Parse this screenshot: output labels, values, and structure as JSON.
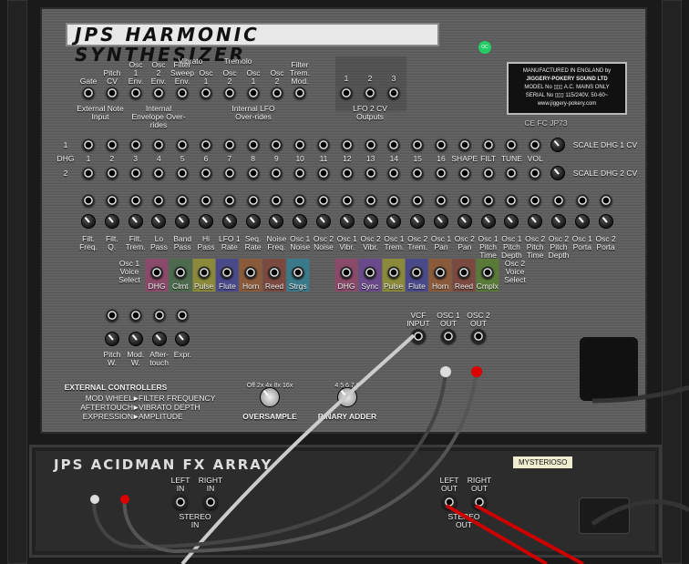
{
  "harmonic": {
    "title": "JPS HARMONIC SYNTHESIZER",
    "led": "OC",
    "top_jacks": [
      [
        "Gate"
      ],
      [
        "Pitch",
        "CV"
      ],
      [
        "Osc",
        "1",
        "Env."
      ],
      [
        "Osc",
        "2",
        "Env."
      ],
      [
        "Filter",
        "Sweep",
        "Env."
      ],
      [
        "Osc",
        "1"
      ],
      [
        "Osc",
        "2"
      ],
      [
        "Osc",
        "1"
      ],
      [
        "Osc",
        "2"
      ],
      [
        "Filter",
        "Trem.",
        "Mod."
      ]
    ],
    "vibrato": "Vibrato",
    "tremolo": "Tremolo",
    "groups": {
      "external": "External Note Input",
      "envelope": "Internal Envelope Over-rides",
      "lfo": "Internal LFO Over-rides",
      "lfo2": "LFO 2 CV Outputs"
    },
    "lfo2_jacks": [
      "1",
      "2",
      "3"
    ],
    "plate": {
      "line1": "MANUFACTURED IN ENGLAND by",
      "line2": "JIGGERY-POKERY SOUND LTD",
      "model": "MODEL No",
      "mains": "A.C. MAINS ONLY",
      "serial": "SERIAL No",
      "volt": "115/240V. 50-60~",
      "url": "www.jiggery-pokery.com",
      "certs": "CE FC JP73"
    },
    "dhg_cols": [
      "1",
      "2",
      "3",
      "4",
      "5",
      "6",
      "7",
      "8",
      "9",
      "10",
      "11",
      "12",
      "13",
      "14",
      "15",
      "16",
      "SHAPE",
      "FILT",
      "TUNE",
      "VOL"
    ],
    "dhg_rows": [
      "1",
      "DHG",
      "2"
    ],
    "scale1": "SCALE DHG 1 CV",
    "scale2": "SCALE DHG 2 CV",
    "knob_cols": [
      [
        "Filt.",
        "Freq."
      ],
      [
        "Filt.",
        "Q."
      ],
      [
        "Filt.",
        "Trem."
      ],
      [
        "Lo",
        "Pass"
      ],
      [
        "Band",
        "Pass"
      ],
      [
        "Hi",
        "Pass"
      ],
      [
        "LFO 1",
        "Rate"
      ],
      [
        "Seq.",
        "Rate"
      ],
      [
        "Noise",
        "Freq."
      ],
      [
        "Osc 1",
        "Noise"
      ],
      [
        "Osc 2",
        "Noise"
      ],
      [
        "Osc 1",
        "Vibr."
      ],
      [
        "Osc 2",
        "Vibr."
      ],
      [
        "Osc 1",
        "Trem."
      ],
      [
        "Osc 2",
        "Trem."
      ],
      [
        "Osc 1",
        "Pan"
      ],
      [
        "Osc 2",
        "Pan"
      ],
      [
        "Osc 1",
        "Pitch",
        "Time"
      ],
      [
        "Osc 1",
        "Pitch",
        "Depth"
      ],
      [
        "Osc 2",
        "Pitch",
        "Time"
      ],
      [
        "Osc 2",
        "Pitch",
        "Depth"
      ],
      [
        "Osc 1",
        "Porta"
      ],
      [
        "Osc 2",
        "Porta"
      ]
    ],
    "osc1_voice_label": [
      "Osc 1",
      "Voice",
      "Select"
    ],
    "osc2_voice_label": [
      "Osc 2",
      "Voice",
      "Select"
    ],
    "osc1_voices": [
      {
        "name": "DHG",
        "color": "#8a4a6a"
      },
      {
        "name": "Clmt",
        "color": "#4e6a4e"
      },
      {
        "name": "Pulse",
        "color": "#8a8a3a"
      },
      {
        "name": "Flute",
        "color": "#4a4a8a"
      },
      {
        "name": "Horn",
        "color": "#8a5a3a"
      },
      {
        "name": "Reed",
        "color": "#7a4a40"
      },
      {
        "name": "Strgs",
        "color": "#3a7a8a"
      }
    ],
    "osc2_voices": [
      {
        "name": "DHG",
        "color": "#8a4a6a"
      },
      {
        "name": "Sync",
        "color": "#6a4a8a"
      },
      {
        "name": "Pulse",
        "color": "#8a8a3a"
      },
      {
        "name": "Flute",
        "color": "#4a4a8a"
      },
      {
        "name": "Horn",
        "color": "#8a5a3a"
      },
      {
        "name": "Reed",
        "color": "#7a4a40"
      },
      {
        "name": "Cmplx",
        "color": "#5a7a3a"
      }
    ],
    "ext_knobs": [
      [
        "Pitch",
        "W."
      ],
      [
        "Mod.",
        "W."
      ],
      [
        "After-",
        "touch"
      ],
      [
        "Expr."
      ]
    ],
    "ext_title": "EXTERNAL CONTROLLERS",
    "ext_map": [
      [
        "MOD WHEEL",
        "FILTER FREQUENCY"
      ],
      [
        "AFTERTOUCH",
        "VIBRATO DEPTH"
      ],
      [
        "EXPRESSION",
        "AMPLITUDE"
      ]
    ],
    "oversample": {
      "label": "OVERSAMPLE",
      "options": "Off 2x 4x 8x 16x"
    },
    "binary": {
      "label": "BINARY ADDER",
      "options": "4 5 6 7 8"
    },
    "vcf": [
      "VCF",
      "INPUT"
    ],
    "osc1out": [
      "OSC 1",
      "OUT"
    ],
    "osc2out": [
      "OSC 2",
      "OUT"
    ]
  },
  "fx": {
    "title": "JPS ACIDMAN FX ARRAY",
    "patch": "MYSTERIOSO",
    "left_in": [
      "LEFT",
      "IN"
    ],
    "right_in": [
      "RIGHT",
      "IN"
    ],
    "stereo_in": [
      "STEREO",
      "IN"
    ],
    "left_out": [
      "LEFT",
      "OUT"
    ],
    "right_out": [
      "RIGHT",
      "OUT"
    ],
    "stereo_out": [
      "STEREO",
      "OUT"
    ]
  }
}
